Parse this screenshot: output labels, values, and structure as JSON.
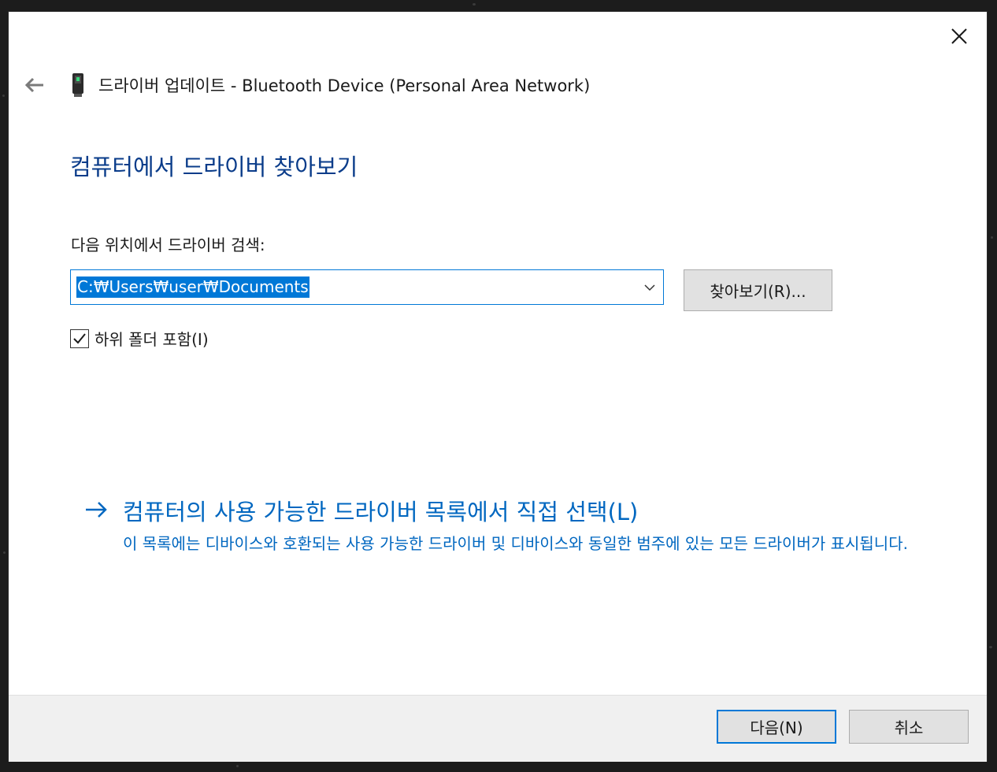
{
  "window": {
    "title": "드라이버 업데이트 - Bluetooth Device (Personal Area Network)",
    "close_icon": "close-icon",
    "back_icon": "back-arrow-icon",
    "device_icon": "network-device-icon"
  },
  "main": {
    "heading": "컴퓨터에서 드라이버 찾아보기",
    "search_label": "다음 위치에서 드라이버 검색:",
    "path_value": "C:₩Users₩user₩Documents",
    "browse_label": "찾아보기(R)...",
    "include_subfolders_label": "하위 폴더 포함(I)",
    "include_subfolders_checked": true,
    "pick_link_label": "컴퓨터의 사용 가능한 드라이버 목록에서 직접 선택(L)",
    "pick_link_description": "이 목록에는 디바이스와 호환되는 사용 가능한 드라이버 및 디바이스와 동일한 범주에 있는 모든 드라이버가 표시됩니다."
  },
  "footer": {
    "next_label": "다음(N)",
    "cancel_label": "취소"
  },
  "colors": {
    "heading": "#0a3c8a",
    "link": "#0067c0",
    "accent": "#0078d7",
    "button_face": "#e1e1e1",
    "footer_bg": "#f0f0f0"
  }
}
